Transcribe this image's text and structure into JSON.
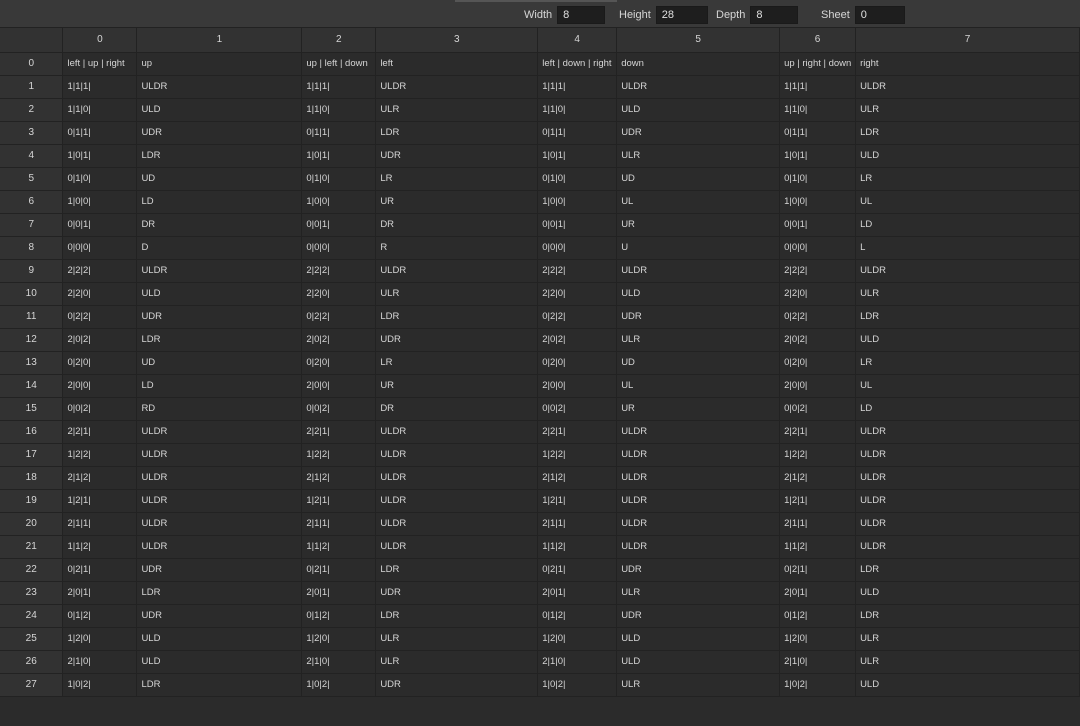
{
  "toolbar": {
    "fields": [
      {
        "label": "Width",
        "value": "8"
      },
      {
        "label": "Height",
        "value": "28"
      },
      {
        "label": "Depth",
        "value": "8"
      },
      {
        "label": "Sheet",
        "value": "0"
      }
    ]
  },
  "columns": [
    "0",
    "1",
    "2",
    "3",
    "4",
    "5",
    "6",
    "7"
  ],
  "rows": [
    [
      "left | up | right",
      "up",
      "up | left | down",
      "left",
      "left | down | right",
      "down",
      "up | right | down",
      "right"
    ],
    [
      "1|1|1|",
      "ULDR",
      "1|1|1|",
      "ULDR",
      "1|1|1|",
      "ULDR",
      "1|1|1|",
      "ULDR"
    ],
    [
      "1|1|0|",
      "ULD",
      "1|1|0|",
      "ULR",
      "1|1|0|",
      "ULD",
      "1|1|0|",
      "ULR"
    ],
    [
      "0|1|1|",
      "UDR",
      "0|1|1|",
      "LDR",
      "0|1|1|",
      "UDR",
      "0|1|1|",
      "LDR"
    ],
    [
      "1|0|1|",
      "LDR",
      "1|0|1|",
      "UDR",
      "1|0|1|",
      "ULR",
      "1|0|1|",
      "ULD"
    ],
    [
      "0|1|0|",
      "UD",
      "0|1|0|",
      "LR",
      "0|1|0|",
      "UD",
      "0|1|0|",
      "LR"
    ],
    [
      "1|0|0|",
      "LD",
      "1|0|0|",
      "UR",
      "1|0|0|",
      "UL",
      "1|0|0|",
      "UL"
    ],
    [
      "0|0|1|",
      "DR",
      "0|0|1|",
      "DR",
      "0|0|1|",
      "UR",
      "0|0|1|",
      "LD"
    ],
    [
      "0|0|0|",
      "D",
      "0|0|0|",
      "R",
      "0|0|0|",
      "U",
      "0|0|0|",
      "L"
    ],
    [
      "2|2|2|",
      "ULDR",
      "2|2|2|",
      "ULDR",
      "2|2|2|",
      "ULDR",
      "2|2|2|",
      "ULDR"
    ],
    [
      "2|2|0|",
      "ULD",
      "2|2|0|",
      "ULR",
      "2|2|0|",
      "ULD",
      "2|2|0|",
      "ULR"
    ],
    [
      "0|2|2|",
      "UDR",
      "0|2|2|",
      "LDR",
      "0|2|2|",
      "UDR",
      "0|2|2|",
      "LDR"
    ],
    [
      "2|0|2|",
      "LDR",
      "2|0|2|",
      "UDR",
      "2|0|2|",
      "ULR",
      "2|0|2|",
      "ULD"
    ],
    [
      "0|2|0|",
      "UD",
      "0|2|0|",
      "LR",
      "0|2|0|",
      "UD",
      "0|2|0|",
      "LR"
    ],
    [
      "2|0|0|",
      "LD",
      "2|0|0|",
      "UR",
      "2|0|0|",
      "UL",
      "2|0|0|",
      "UL"
    ],
    [
      "0|0|2|",
      "RD",
      "0|0|2|",
      "DR",
      "0|0|2|",
      "UR",
      "0|0|2|",
      "LD"
    ],
    [
      "2|2|1|",
      "ULDR",
      "2|2|1|",
      "ULDR",
      "2|2|1|",
      "ULDR",
      "2|2|1|",
      "ULDR"
    ],
    [
      "1|2|2|",
      "ULDR",
      "1|2|2|",
      "ULDR",
      "1|2|2|",
      "ULDR",
      "1|2|2|",
      "ULDR"
    ],
    [
      "2|1|2|",
      "ULDR",
      "2|1|2|",
      "ULDR",
      "2|1|2|",
      "ULDR",
      "2|1|2|",
      "ULDR"
    ],
    [
      "1|2|1|",
      "ULDR",
      "1|2|1|",
      "ULDR",
      "1|2|1|",
      "ULDR",
      "1|2|1|",
      "ULDR"
    ],
    [
      "2|1|1|",
      "ULDR",
      "2|1|1|",
      "ULDR",
      "2|1|1|",
      "ULDR",
      "2|1|1|",
      "ULDR"
    ],
    [
      "1|1|2|",
      "ULDR",
      "1|1|2|",
      "ULDR",
      "1|1|2|",
      "ULDR",
      "1|1|2|",
      "ULDR"
    ],
    [
      "0|2|1|",
      "UDR",
      "0|2|1|",
      "LDR",
      "0|2|1|",
      "UDR",
      "0|2|1|",
      "LDR"
    ],
    [
      "2|0|1|",
      "LDR",
      "2|0|1|",
      "UDR",
      "2|0|1|",
      "ULR",
      "2|0|1|",
      "ULD"
    ],
    [
      "0|1|2|",
      "UDR",
      "0|1|2|",
      "LDR",
      "0|1|2|",
      "UDR",
      "0|1|2|",
      "LDR"
    ],
    [
      "1|2|0|",
      "ULD",
      "1|2|0|",
      "ULR",
      "1|2|0|",
      "ULD",
      "1|2|0|",
      "ULR"
    ],
    [
      "2|1|0|",
      "ULD",
      "2|1|0|",
      "ULR",
      "2|1|0|",
      "ULD",
      "2|1|0|",
      "ULR"
    ],
    [
      "1|0|2|",
      "LDR",
      "1|0|2|",
      "UDR",
      "1|0|2|",
      "ULR",
      "1|0|2|",
      "ULD"
    ]
  ]
}
